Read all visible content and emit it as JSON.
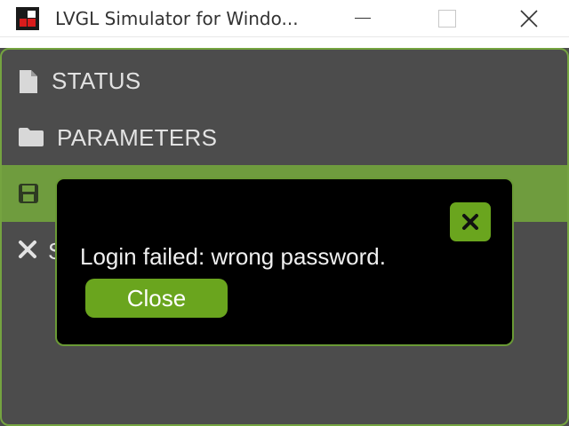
{
  "window": {
    "title": "LVGL Simulator for Windo...",
    "logo_icon": "lvgl-logo-icon",
    "controls": [
      "minimize",
      "maximize",
      "close"
    ]
  },
  "menu": {
    "items": [
      {
        "label": "STATUS",
        "icon": "document-icon",
        "selected": false
      },
      {
        "label": "PARAMETERS",
        "icon": "folder-icon",
        "selected": false
      },
      {
        "label": "",
        "icon": "save-icon",
        "selected": true
      },
      {
        "label": "S",
        "icon": "close-x-icon",
        "selected": false
      }
    ]
  },
  "modal": {
    "message": "Login failed: wrong password.",
    "button_label": "Close",
    "close_icon": "close-icon"
  },
  "colors": {
    "accent": "#6aa51e",
    "selected_row": "#6f9c3e",
    "screen_bg": "#4c4c4c",
    "modal_bg": "#000000",
    "text": "#e2e2e2"
  }
}
